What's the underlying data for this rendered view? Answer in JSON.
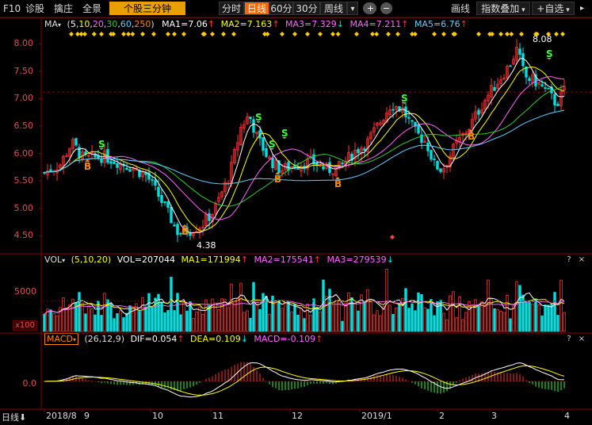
{
  "toolbar": {
    "left_items": [
      "F10",
      "诊股",
      "擒庄",
      "全景"
    ],
    "highlight_item": "个股三分钟",
    "periods": [
      "分时",
      "日线",
      "60分",
      "30分",
      "周线"
    ],
    "selected_period": "日线",
    "period_dropdown_arrow": "▾",
    "prev_symbol": "◀",
    "plus_symbol": "+",
    "minus_symbol": "−",
    "right_items": [
      "画线",
      "指数叠加",
      "+自选"
    ]
  },
  "colors": {
    "up": "#ff3333",
    "down": "#00e0e0",
    "ma1": "#ffffff",
    "ma2": "#ffff00",
    "ma3": "#ff66ff",
    "ma4": "#33cc33",
    "ma5": "#66ccff",
    "grid": "#8b0000",
    "buy_signal": "#ff8800",
    "sell_signal": "#33ff33"
  },
  "ma_legend": {
    "title": "MA",
    "params_open": "(",
    "params": [
      "5",
      "10",
      "20",
      "30",
      "60",
      "250"
    ],
    "params_close": ")",
    "ma1": "MA1=7.06",
    "ma2": "MA2=7.163",
    "ma3": "MA3=7.329",
    "ma4": "MA4=7.211",
    "ma5": "MA5=6.76",
    "ma1_arrow": "↑",
    "ma2_arrow": "↑",
    "ma3_arrow": "↓",
    "ma4_arrow": "↑",
    "ma5_arrow": "↑"
  },
  "price_axis": [
    "8.00",
    "7.50",
    "7.00",
    "6.50",
    "6.00",
    "5.50",
    "5.00",
    "4.50"
  ],
  "price_annotations": {
    "high": "8.08",
    "low": "4.38"
  },
  "signals": {
    "buy": "B",
    "sell": "S"
  },
  "vol_legend": {
    "title": "VOL",
    "params": "(5,10,20)",
    "vol": "VOL=207044",
    "ma1": "MA1=171994",
    "ma2": "MA2=175541",
    "ma3": "MA3=279539",
    "ma1_arrow": "↑",
    "ma2_arrow": "↑",
    "ma3_arrow": "↓"
  },
  "vol_axis": {
    "tick": "5000",
    "unit": "x100"
  },
  "macd_legend": {
    "title": "MACD",
    "params": "(26,12,9)",
    "dif": "DIF=0.054",
    "dea": "DEA=0.109",
    "macd": "MACD=-0.109",
    "dif_arrow": "↑",
    "dea_arrow": "↓",
    "macd_arrow": "↑"
  },
  "macd_axis": {
    "zero": "0.0"
  },
  "panel_buttons": {
    "help": "?",
    "close": "×"
  },
  "x_axis": {
    "mode": "日线",
    "labels": [
      "2018/8",
      "9",
      "10",
      "11",
      "12",
      "2019/1",
      "2",
      "3",
      "4"
    ]
  }
}
